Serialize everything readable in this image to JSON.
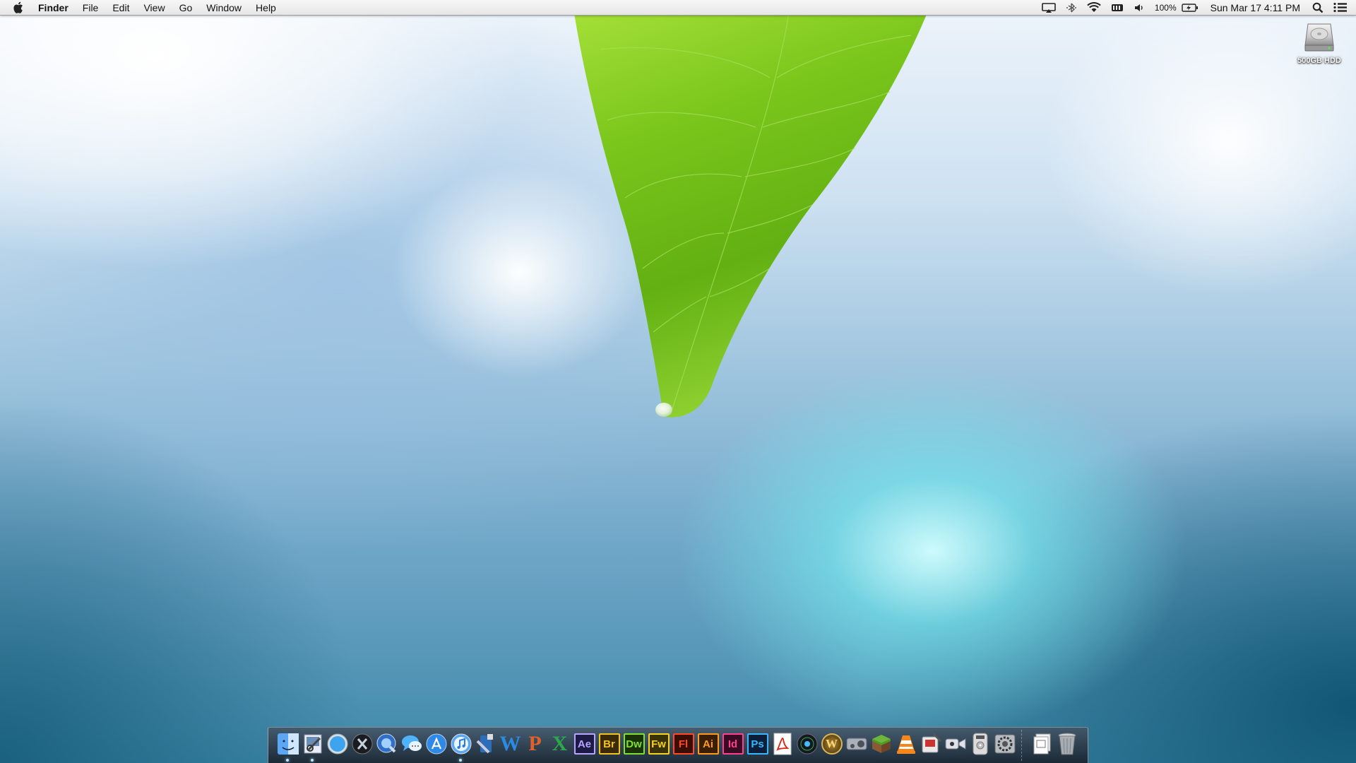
{
  "menubar": {
    "app_name": "Finder",
    "menus": [
      "File",
      "Edit",
      "View",
      "Go",
      "Window",
      "Help"
    ],
    "battery_percent": "100%",
    "datetime": "Sun Mar 17  4:11 PM",
    "status_icons": [
      "airplay-icon",
      "bluetooth-icon",
      "wifi-icon",
      "battery-bar-icon",
      "volume-icon",
      "battery-icon",
      "spotlight-icon",
      "notification-center-icon"
    ]
  },
  "desktop": {
    "drive_label": "500GB HDD"
  },
  "dock": {
    "apps": [
      {
        "name": "finder-icon",
        "running": true
      },
      {
        "name": "preview-icon",
        "running": true
      },
      {
        "name": "safari-icon",
        "running": false
      },
      {
        "name": "mission-control-icon",
        "running": false
      },
      {
        "name": "quicktime-icon",
        "running": false
      },
      {
        "name": "messages-icon",
        "running": false
      },
      {
        "name": "app-store-icon",
        "running": false
      },
      {
        "name": "itunes-icon",
        "running": true
      },
      {
        "name": "xcode-icon",
        "running": false
      },
      {
        "name": "word-icon",
        "label": "W",
        "color": "#2b8ae2"
      },
      {
        "name": "powerpoint-icon",
        "label": "P",
        "color": "#e0622b"
      },
      {
        "name": "excel-icon",
        "label": "X",
        "color": "#2aa84a"
      },
      {
        "name": "after-effects-icon",
        "label": "Ae",
        "color": "#b6a4ff",
        "bg": "#1e1a46"
      },
      {
        "name": "bridge-icon",
        "label": "Br",
        "color": "#f2c21e",
        "bg": "#3a2a05"
      },
      {
        "name": "dreamweaver-icon",
        "label": "Dw",
        "color": "#7fe02e",
        "bg": "#193208"
      },
      {
        "name": "fireworks-icon",
        "label": "Fw",
        "color": "#f5d21d",
        "bg": "#3a3105"
      },
      {
        "name": "flash-icon",
        "label": "Fl",
        "color": "#ff4a2a",
        "bg": "#3a0d05"
      },
      {
        "name": "illustrator-icon",
        "label": "Ai",
        "color": "#ff9a1d",
        "bg": "#3a1f05"
      },
      {
        "name": "indesign-icon",
        "label": "Id",
        "color": "#ff3f8f",
        "bg": "#3a0a22"
      },
      {
        "name": "photoshop-icon",
        "label": "Ps",
        "color": "#38b6ff",
        "bg": "#0a1f3a"
      },
      {
        "name": "acrobat-icon",
        "running": false
      },
      {
        "name": "logic-icon",
        "running": false
      },
      {
        "name": "world-of-warcraft-icon",
        "label": "W"
      },
      {
        "name": "steam-icon",
        "running": false
      },
      {
        "name": "minecraft-icon",
        "running": false
      },
      {
        "name": "vlc-icon",
        "running": false
      },
      {
        "name": "utility-icon",
        "running": false
      },
      {
        "name": "facetime-icon",
        "running": false
      },
      {
        "name": "dvd-player-icon",
        "running": false
      },
      {
        "name": "system-preferences-icon",
        "running": false
      }
    ],
    "trash_label": "Trash"
  }
}
